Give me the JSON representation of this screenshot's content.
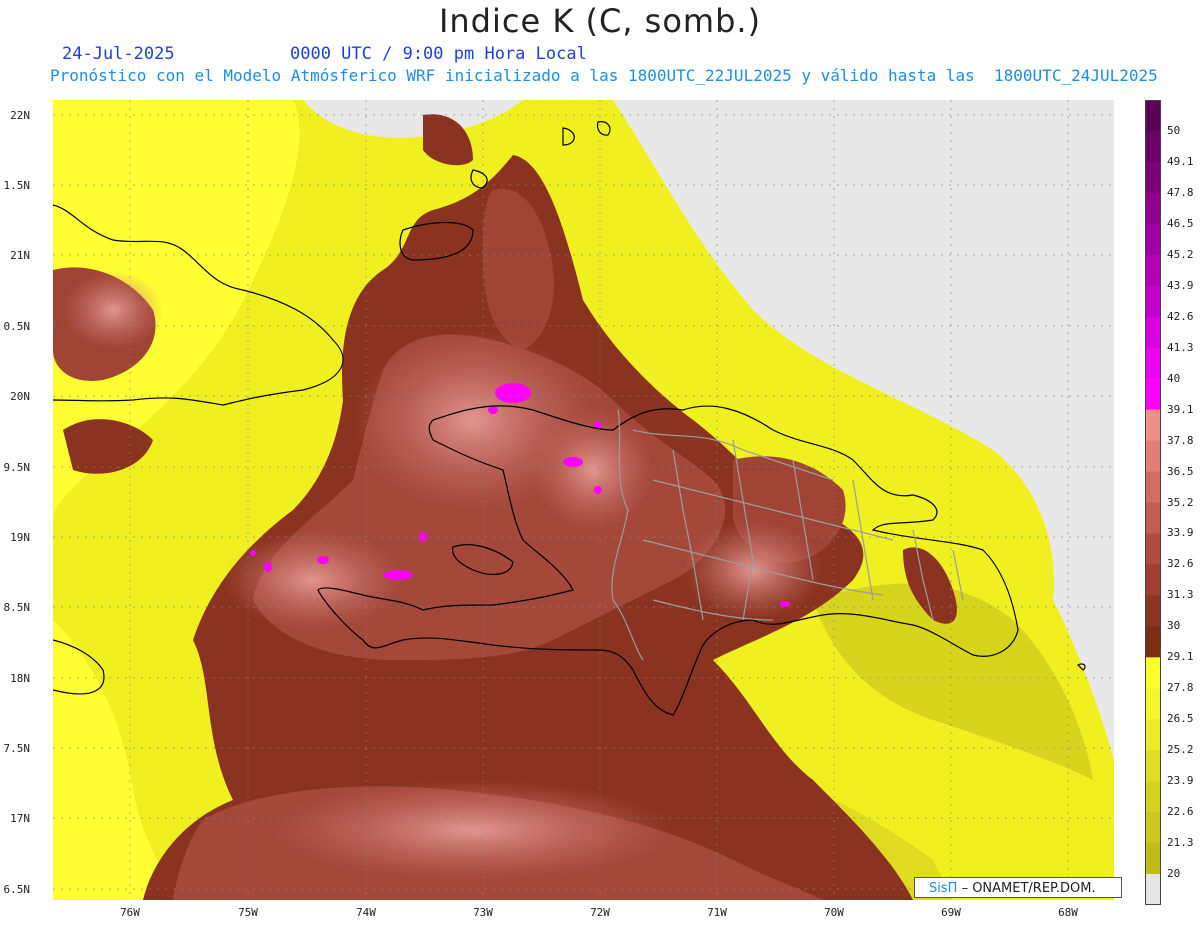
{
  "header": {
    "title": "Indice K (C, somb.)",
    "date": "24-Jul-2025",
    "time": "0000 UTC / 9:00 pm Hora Local",
    "description": "Pronóstico con el Modelo Atmósferico WRF inicializado a las 1800UTC_22JUL2025 y válido hasta las  1800UTC_24JUL2025"
  },
  "map": {
    "lat_labels": [
      "22N",
      "1.5N",
      "21N",
      "0.5N",
      "20N",
      "9.5N",
      "19N",
      "8.5N",
      "18N",
      "7.5N",
      "17N",
      "6.5N"
    ],
    "lon_labels": [
      "76W",
      "75W",
      "74W",
      "73W",
      "72W",
      "71W",
      "70W",
      "69W",
      "68W"
    ],
    "regions": [
      "Cuba",
      "Haiti",
      "República Dominicana",
      "Turks and Caicos",
      "Bahamas"
    ],
    "colors": {
      "no_data": "#e8e8e8",
      "yellow_bright": "#ffff33",
      "yellow_mid": "#ecee2a",
      "yellow_dark": "#d4cf1c",
      "brown_dark": "#7f2f19",
      "brown_mid": "#a8473a",
      "brown_light": "#c8675e",
      "pink_light": "#df8a84",
      "magenta": "#ff00ff",
      "coastline": "#000000",
      "borders": "#9a9a9a"
    }
  },
  "colorbar": {
    "labels": [
      "50",
      "49.1",
      "47.8",
      "46.5",
      "45.2",
      "43.9",
      "42.6",
      "41.3",
      "40",
      "39.1",
      "37.8",
      "36.5",
      "35.2",
      "33.9",
      "32.6",
      "31.3",
      "30",
      "29.1",
      "27.8",
      "26.5",
      "25.2",
      "23.9",
      "22.6",
      "21.3",
      "20"
    ],
    "colors": [
      "#5a0055",
      "#6b0068",
      "#7d007b",
      "#8f008f",
      "#a100a3",
      "#b300b7",
      "#c600cb",
      "#d800df",
      "#eb00f2",
      "#ff00ff",
      "#f0908a",
      "#e37e76",
      "#d46c63",
      "#c25b50",
      "#b14a40",
      "#a03e31",
      "#8c3521",
      "#7c2d14",
      "#ffff2e",
      "#f4f52c",
      "#ebeb28",
      "#e0de24",
      "#d6d320",
      "#ccc71c",
      "#c2bc18",
      "#e6e6e6"
    ]
  },
  "credit": {
    "logo": "SisΠ",
    "text": "– ONAMET/REP.DOM."
  }
}
